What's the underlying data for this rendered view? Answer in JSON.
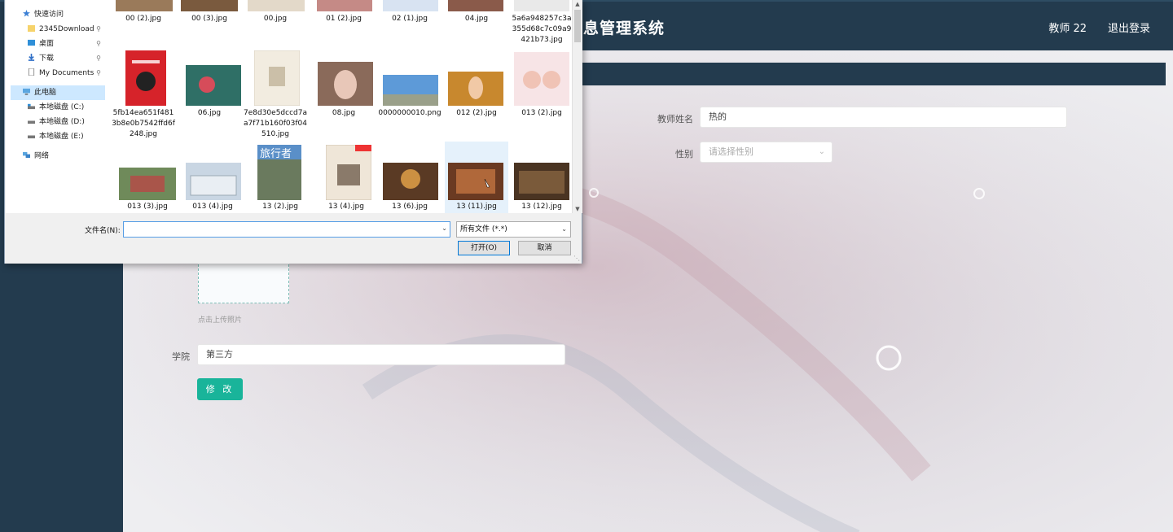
{
  "app": {
    "title": "息管理系统",
    "user": "教师 22",
    "logout": "退出登录"
  },
  "form": {
    "teacher_name_label": "教师姓名",
    "teacher_name_value": "热的",
    "gender_label": "性别",
    "gender_placeholder": "请选择性别",
    "upload_hint": "点击上传照片",
    "college_label": "学院",
    "college_value": "第三方",
    "submit_label": "修 改"
  },
  "dialog": {
    "nav": {
      "quick_access": "快速访问",
      "downloads_2345": "2345Download",
      "desktop": "桌面",
      "downloads": "下载",
      "my_documents": "My Documents",
      "this_pc": "此电脑",
      "drive_c": "本地磁盘 (C:)",
      "drive_d": "本地磁盘 (D:)",
      "drive_e": "本地磁盘 (E:)",
      "network": "网络"
    },
    "files": [
      "00 (2).jpg",
      "00 (3).jpg",
      "00.jpg",
      "01 (2).jpg",
      "02 (1).jpg",
      "04.jpg",
      "5a6a948257c3a355d68c7c09a9421b73.jpg",
      "5fb14ea651f4813b8e0b7542ffd6f248.jpg",
      "06.jpg",
      "7e8d30e5dccd7aa7f71b160f03f04510.jpg",
      "08.jpg",
      "0000000010.png",
      "012 (2).jpg",
      "013 (2).jpg",
      "013 (3).jpg",
      "013 (4).jpg",
      "13 (2).jpg",
      "13 (4).jpg",
      "13 (6).jpg",
      "13 (11).jpg",
      "13 (12).jpg"
    ],
    "filename_label": "文件名(N):",
    "filename_value": "",
    "filetype": "所有文件 (*.*)",
    "open_button": "打开(O)",
    "cancel_button": "取消"
  },
  "icons": [
    "star-icon",
    "folder-icon",
    "desktop-icon",
    "download-icon",
    "document-icon",
    "pc-icon",
    "drive-icon",
    "network-icon",
    "pin-icon",
    "chevron-down-icon"
  ],
  "colors": {
    "header": "#233b4e",
    "accent": "#19b49a",
    "selection": "#cde8ff"
  }
}
